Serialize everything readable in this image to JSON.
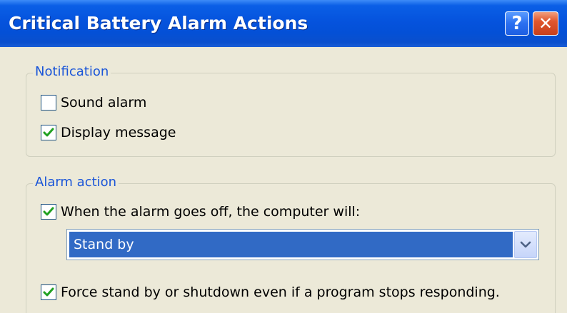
{
  "window": {
    "title": "Critical Battery Alarm Actions",
    "help_label": "?",
    "close_label": "✕"
  },
  "notification": {
    "legend": "Notification",
    "sound_alarm": {
      "label": "Sound alarm",
      "checked": false
    },
    "display_message": {
      "label": "Display message",
      "checked": true
    }
  },
  "alarm_action": {
    "legend": "Alarm action",
    "when_alarm": {
      "label": "When the alarm goes off, the computer will:",
      "checked": true
    },
    "action_select": {
      "value": "Stand by"
    },
    "force": {
      "label": "Force stand by or shutdown even if a program stops responding.",
      "checked": true
    }
  },
  "colors": {
    "titlebar": "#0553dd",
    "dialog_bg": "#ECE9D8",
    "legend_text": "#1a55d8",
    "checkmark": "#21a121",
    "selection": "#316ac5"
  }
}
